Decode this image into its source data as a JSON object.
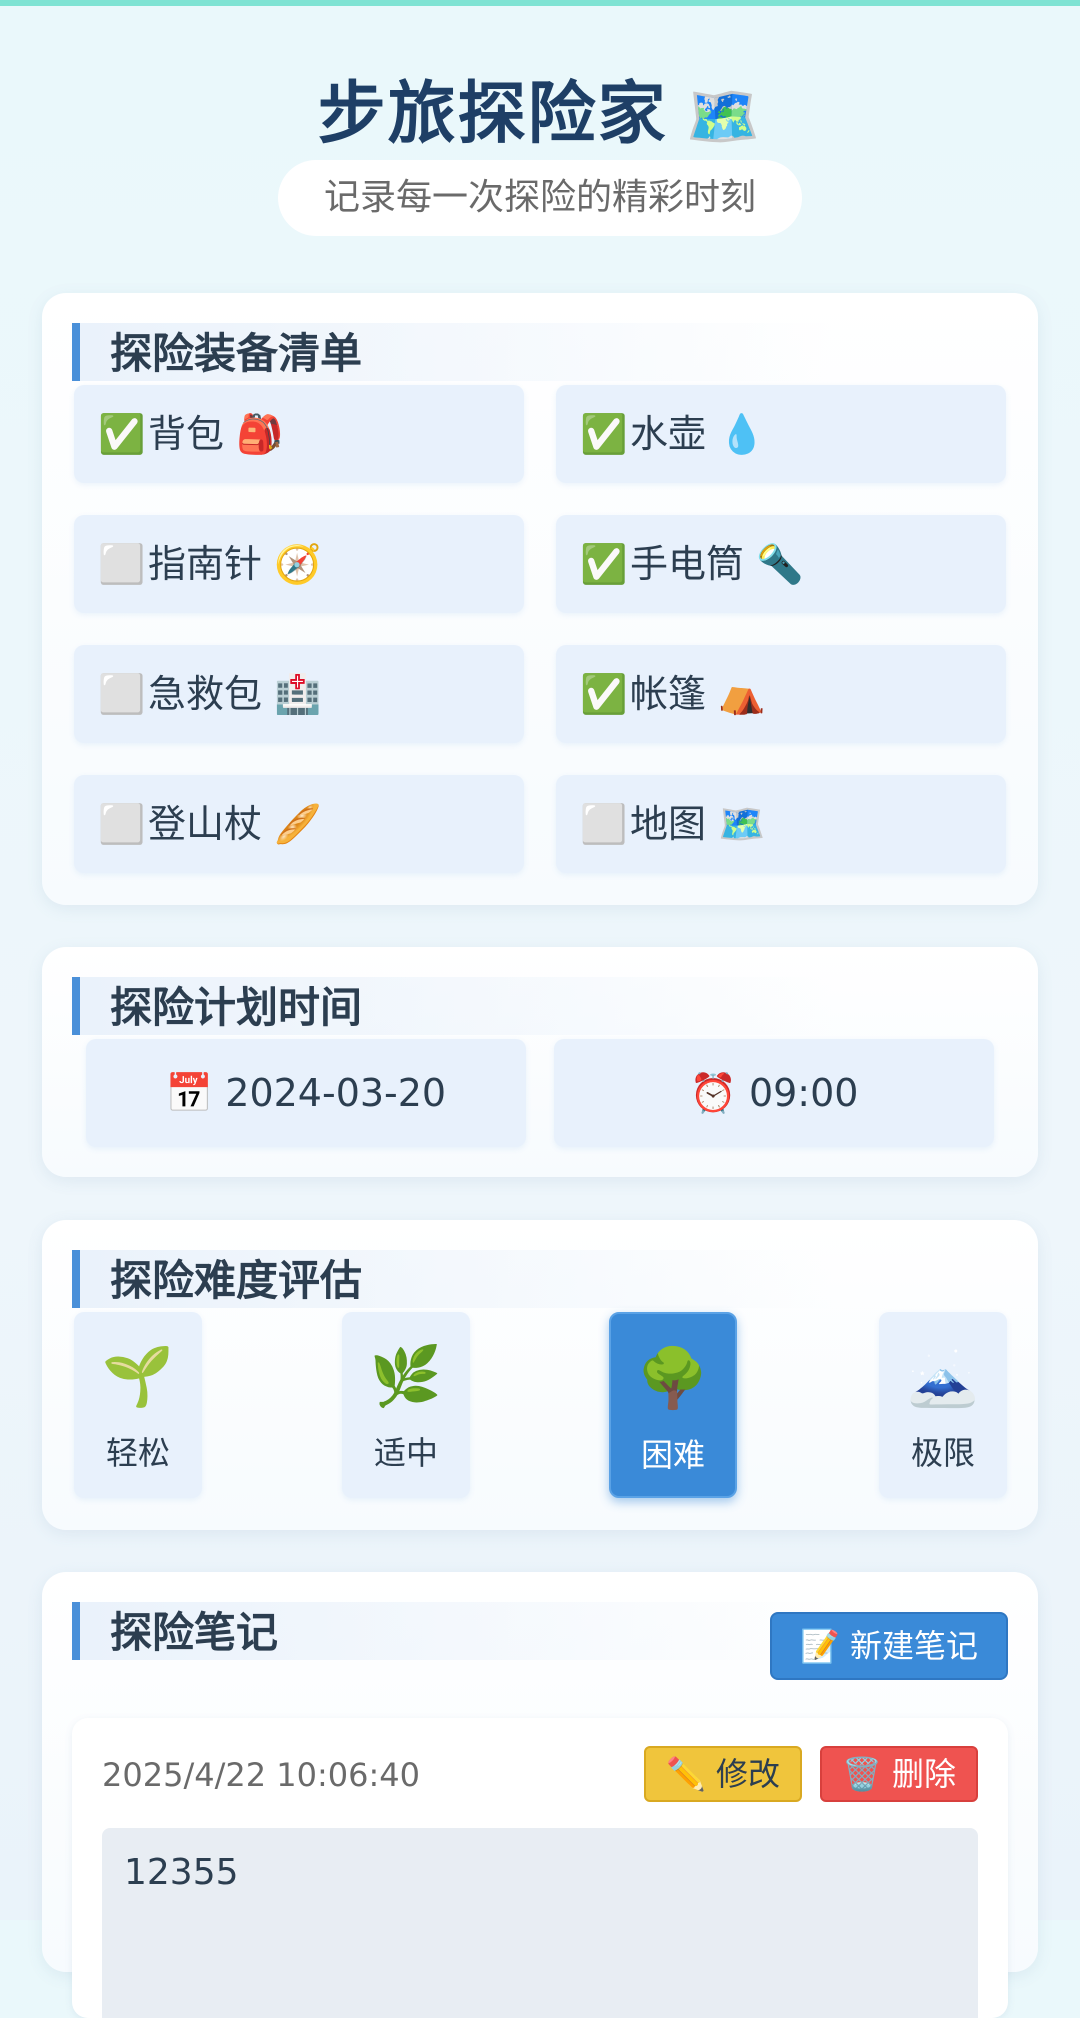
{
  "header": {
    "title": "步旅探险家",
    "title_emoji": "🗺️",
    "subtitle": "记录每一次探险的精彩时刻"
  },
  "equipment": {
    "title": "探险装备清单",
    "items": [
      {
        "checked": "✅",
        "label": "背包 🎒"
      },
      {
        "checked": "✅",
        "label": "水壶 💧"
      },
      {
        "checked": "⬜",
        "label": "指南针 🧭"
      },
      {
        "checked": "✅",
        "label": "手电筒 🔦"
      },
      {
        "checked": "⬜",
        "label": "急救包 🏥"
      },
      {
        "checked": "✅",
        "label": "帐篷 ⛺"
      },
      {
        "checked": "⬜",
        "label": "登山杖 🥖"
      },
      {
        "checked": "⬜",
        "label": "地图 🗺️"
      }
    ]
  },
  "schedule": {
    "title": "探险计划时间",
    "date": "📅 2024-03-20",
    "time": "⏰ 09:00"
  },
  "difficulty": {
    "title": "探险难度评估",
    "levels": [
      {
        "icon": "🌱",
        "label": "轻松"
      },
      {
        "icon": "🌿",
        "label": "适中"
      },
      {
        "icon": "🌳",
        "label": "困难"
      },
      {
        "icon": "🗻",
        "label": "极限"
      }
    ],
    "selected": "困难"
  },
  "notes": {
    "title": "探险笔记",
    "new_button": "📝 新建笔记",
    "items": [
      {
        "time": "2025/4/22 10:06:40",
        "edit_label": "✏️ 修改",
        "delete_label": "🗑️ 删除",
        "content": "12355"
      }
    ]
  },
  "colors": {
    "accent": "#4a90d9",
    "active": "#3a8ad8",
    "edit": "#f0c53c",
    "delete": "#ef5350"
  }
}
